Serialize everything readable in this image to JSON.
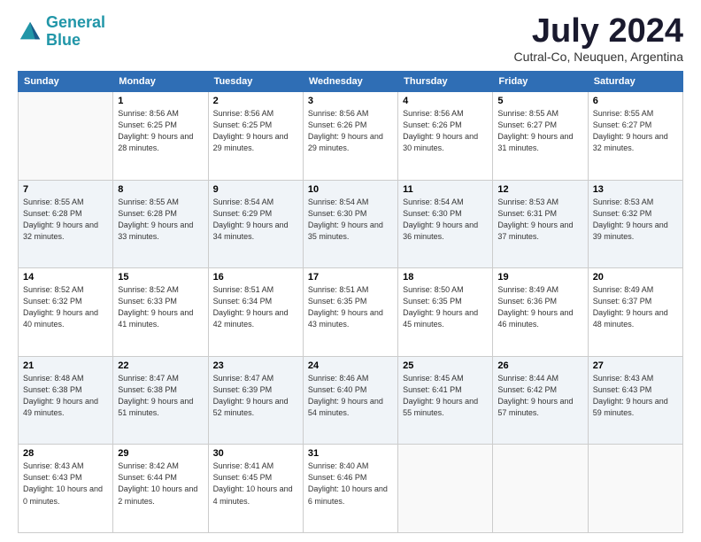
{
  "logo": {
    "line1": "General",
    "line2": "Blue"
  },
  "title": "July 2024",
  "subtitle": "Cutral-Co, Neuquen, Argentina",
  "days_of_week": [
    "Sunday",
    "Monday",
    "Tuesday",
    "Wednesday",
    "Thursday",
    "Friday",
    "Saturday"
  ],
  "weeks": [
    [
      {
        "day": "",
        "empty": true
      },
      {
        "day": "1",
        "sunrise": "8:56 AM",
        "sunset": "6:25 PM",
        "daylight": "9 hours and 28 minutes."
      },
      {
        "day": "2",
        "sunrise": "8:56 AM",
        "sunset": "6:25 PM",
        "daylight": "9 hours and 29 minutes."
      },
      {
        "day": "3",
        "sunrise": "8:56 AM",
        "sunset": "6:26 PM",
        "daylight": "9 hours and 29 minutes."
      },
      {
        "day": "4",
        "sunrise": "8:56 AM",
        "sunset": "6:26 PM",
        "daylight": "9 hours and 30 minutes."
      },
      {
        "day": "5",
        "sunrise": "8:55 AM",
        "sunset": "6:27 PM",
        "daylight": "9 hours and 31 minutes."
      },
      {
        "day": "6",
        "sunrise": "8:55 AM",
        "sunset": "6:27 PM",
        "daylight": "9 hours and 32 minutes."
      }
    ],
    [
      {
        "day": "7",
        "sunrise": "8:55 AM",
        "sunset": "6:28 PM",
        "daylight": "9 hours and 32 minutes."
      },
      {
        "day": "8",
        "sunrise": "8:55 AM",
        "sunset": "6:28 PM",
        "daylight": "9 hours and 33 minutes."
      },
      {
        "day": "9",
        "sunrise": "8:54 AM",
        "sunset": "6:29 PM",
        "daylight": "9 hours and 34 minutes."
      },
      {
        "day": "10",
        "sunrise": "8:54 AM",
        "sunset": "6:30 PM",
        "daylight": "9 hours and 35 minutes."
      },
      {
        "day": "11",
        "sunrise": "8:54 AM",
        "sunset": "6:30 PM",
        "daylight": "9 hours and 36 minutes."
      },
      {
        "day": "12",
        "sunrise": "8:53 AM",
        "sunset": "6:31 PM",
        "daylight": "9 hours and 37 minutes."
      },
      {
        "day": "13",
        "sunrise": "8:53 AM",
        "sunset": "6:32 PM",
        "daylight": "9 hours and 39 minutes."
      }
    ],
    [
      {
        "day": "14",
        "sunrise": "8:52 AM",
        "sunset": "6:32 PM",
        "daylight": "9 hours and 40 minutes."
      },
      {
        "day": "15",
        "sunrise": "8:52 AM",
        "sunset": "6:33 PM",
        "daylight": "9 hours and 41 minutes."
      },
      {
        "day": "16",
        "sunrise": "8:51 AM",
        "sunset": "6:34 PM",
        "daylight": "9 hours and 42 minutes."
      },
      {
        "day": "17",
        "sunrise": "8:51 AM",
        "sunset": "6:35 PM",
        "daylight": "9 hours and 43 minutes."
      },
      {
        "day": "18",
        "sunrise": "8:50 AM",
        "sunset": "6:35 PM",
        "daylight": "9 hours and 45 minutes."
      },
      {
        "day": "19",
        "sunrise": "8:49 AM",
        "sunset": "6:36 PM",
        "daylight": "9 hours and 46 minutes."
      },
      {
        "day": "20",
        "sunrise": "8:49 AM",
        "sunset": "6:37 PM",
        "daylight": "9 hours and 48 minutes."
      }
    ],
    [
      {
        "day": "21",
        "sunrise": "8:48 AM",
        "sunset": "6:38 PM",
        "daylight": "9 hours and 49 minutes."
      },
      {
        "day": "22",
        "sunrise": "8:47 AM",
        "sunset": "6:38 PM",
        "daylight": "9 hours and 51 minutes."
      },
      {
        "day": "23",
        "sunrise": "8:47 AM",
        "sunset": "6:39 PM",
        "daylight": "9 hours and 52 minutes."
      },
      {
        "day": "24",
        "sunrise": "8:46 AM",
        "sunset": "6:40 PM",
        "daylight": "9 hours and 54 minutes."
      },
      {
        "day": "25",
        "sunrise": "8:45 AM",
        "sunset": "6:41 PM",
        "daylight": "9 hours and 55 minutes."
      },
      {
        "day": "26",
        "sunrise": "8:44 AM",
        "sunset": "6:42 PM",
        "daylight": "9 hours and 57 minutes."
      },
      {
        "day": "27",
        "sunrise": "8:43 AM",
        "sunset": "6:43 PM",
        "daylight": "9 hours and 59 minutes."
      }
    ],
    [
      {
        "day": "28",
        "sunrise": "8:43 AM",
        "sunset": "6:43 PM",
        "daylight": "10 hours and 0 minutes."
      },
      {
        "day": "29",
        "sunrise": "8:42 AM",
        "sunset": "6:44 PM",
        "daylight": "10 hours and 2 minutes."
      },
      {
        "day": "30",
        "sunrise": "8:41 AM",
        "sunset": "6:45 PM",
        "daylight": "10 hours and 4 minutes."
      },
      {
        "day": "31",
        "sunrise": "8:40 AM",
        "sunset": "6:46 PM",
        "daylight": "10 hours and 6 minutes."
      },
      {
        "day": "",
        "empty": true
      },
      {
        "day": "",
        "empty": true
      },
      {
        "day": "",
        "empty": true
      }
    ]
  ]
}
